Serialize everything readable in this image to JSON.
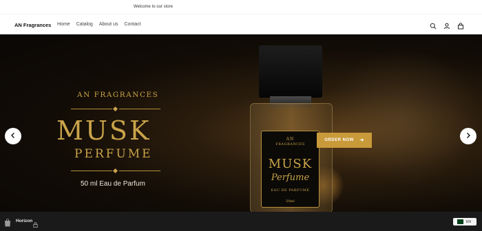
{
  "announcement": "Welcome to our store",
  "header": {
    "brand": "AN Fragrances",
    "nav": [
      "Home",
      "Catalog",
      "About us",
      "Contact"
    ],
    "icons": [
      "search-icon",
      "account-icon",
      "cart-icon"
    ]
  },
  "hero": {
    "brand_line": "AN FRAGRANCES",
    "title_line1": "MUSK",
    "title_line2": "PERFUME",
    "volume": "50 ml Eau de Parfum",
    "cta": "ORDER NOW",
    "label": {
      "line1": "AN",
      "line2": "FRAGRANCES",
      "line3": "MUSK",
      "line4": "Perfume",
      "line5": "EAU DE PARFUME",
      "line6": "50ml"
    },
    "accent_color": "#c9a44a",
    "button_color": "#c99a3a"
  },
  "footer": {
    "theme_name": "Horizon",
    "language": "EN"
  }
}
